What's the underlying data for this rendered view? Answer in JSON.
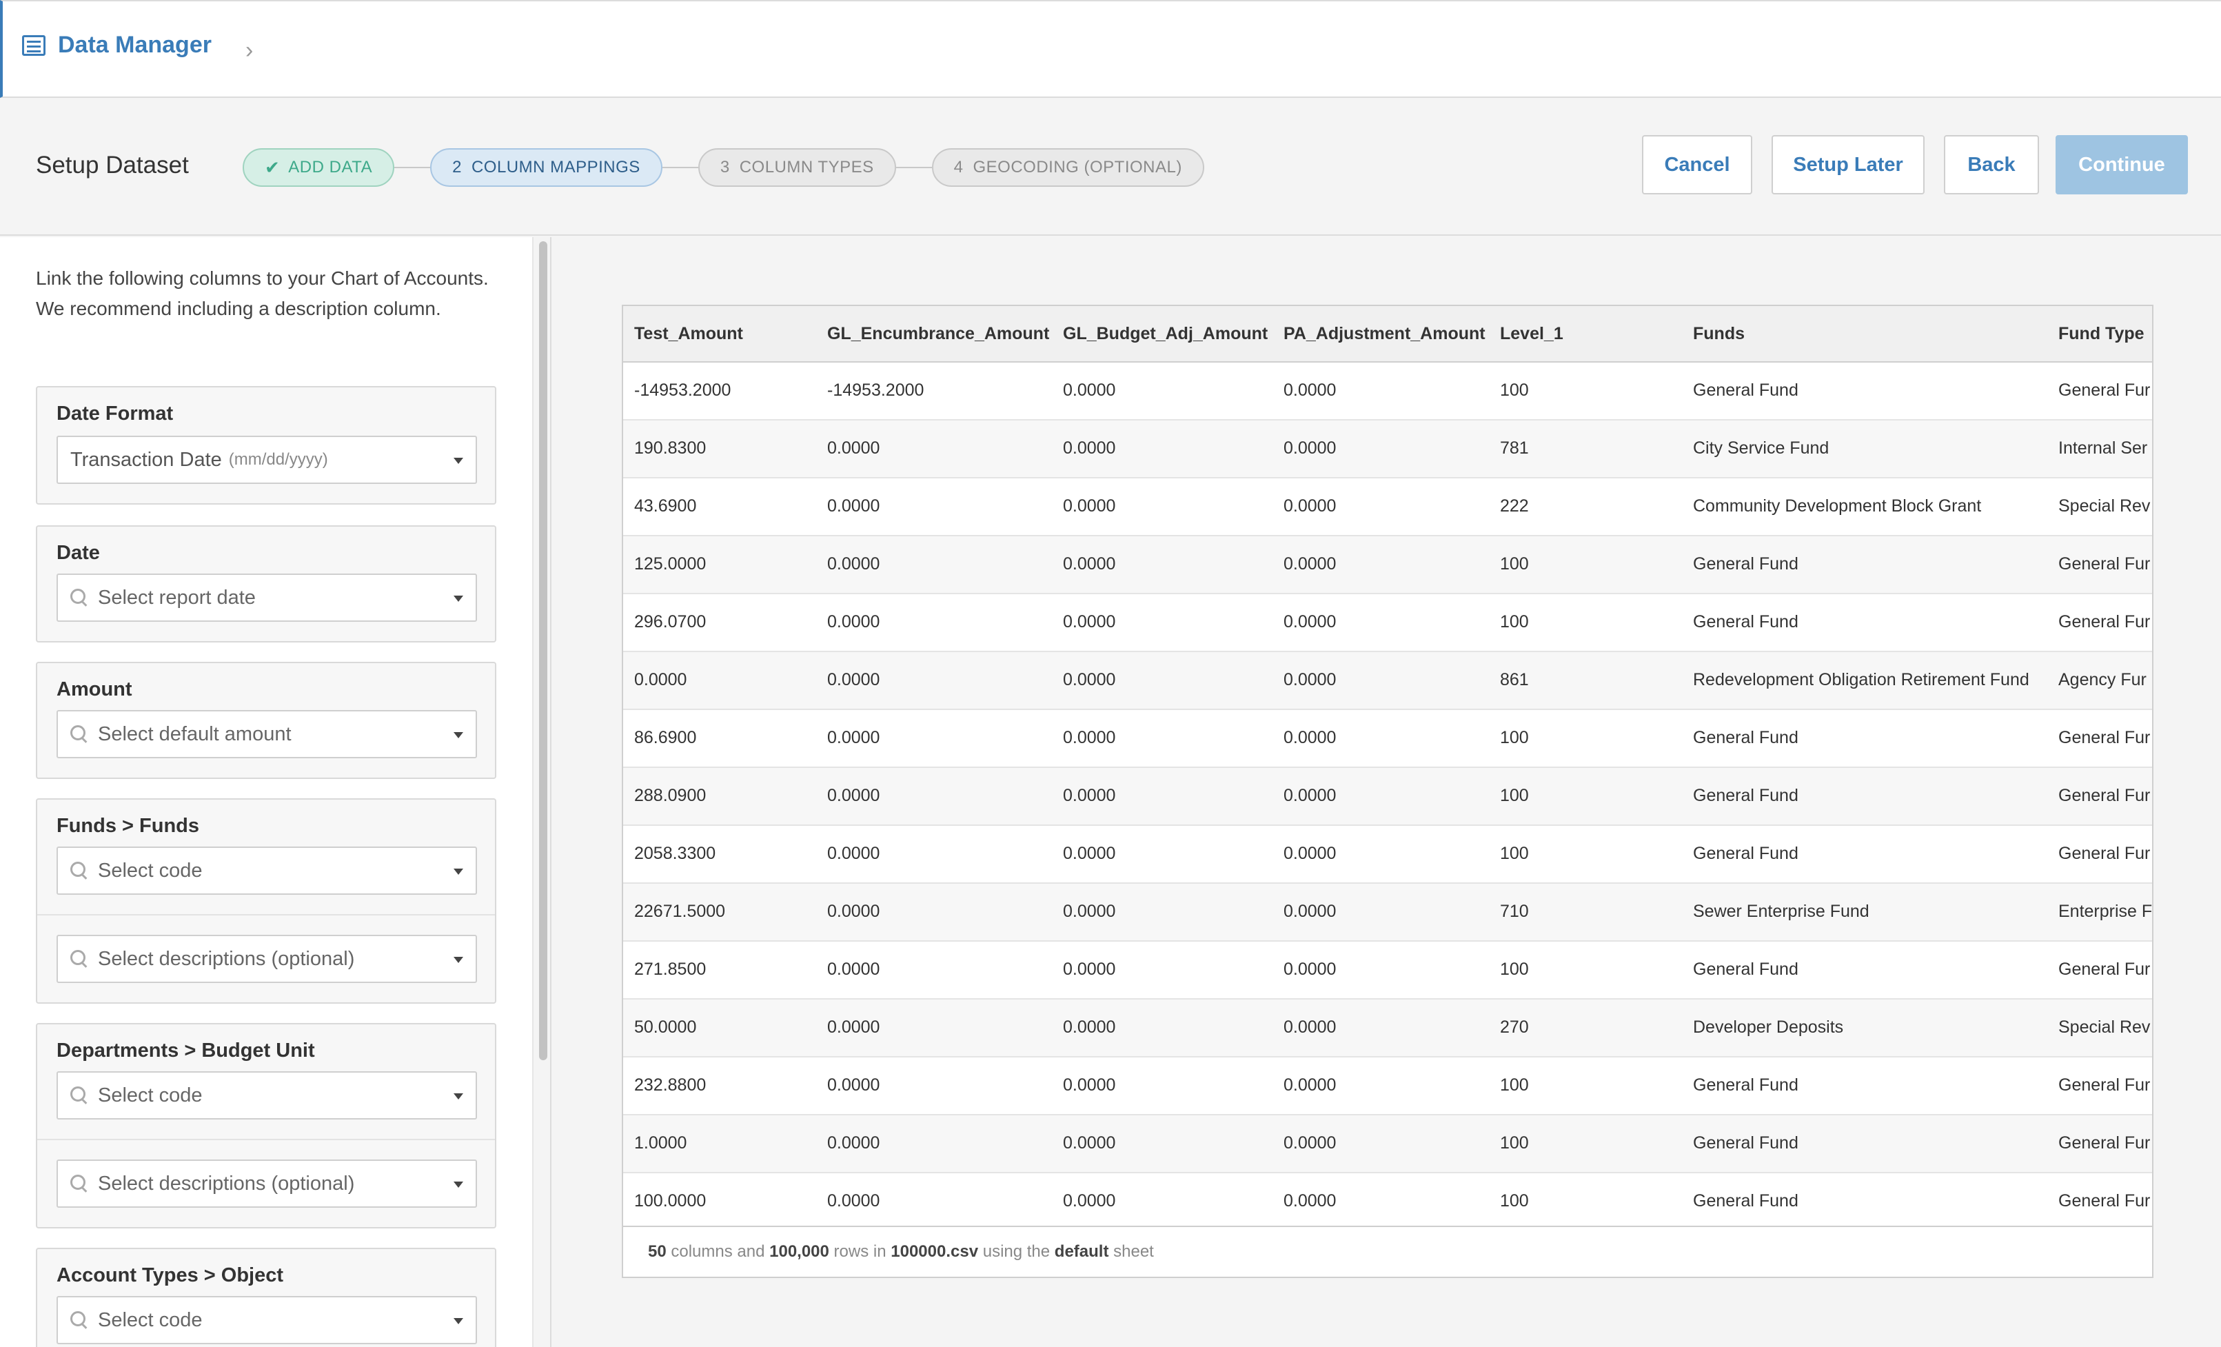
{
  "header": {
    "brand_icon": "monitor-icon",
    "title": "Data Manager",
    "chevron_icon": "chevron-right-icon",
    "chevron": "›"
  },
  "setup": {
    "title": "Setup Dataset",
    "steps": [
      {
        "num": "",
        "label": "ADD DATA",
        "state": "done",
        "check": "✔"
      },
      {
        "num": "2",
        "label": "COLUMN MAPPINGS",
        "state": "active"
      },
      {
        "num": "3",
        "label": "COLUMN TYPES",
        "state": "pending"
      },
      {
        "num": "4",
        "label": "GEOCODING (OPTIONAL)",
        "state": "pending"
      }
    ],
    "buttons": {
      "cancel": "Cancel",
      "setup_later": "Setup Later",
      "back": "Back",
      "continue": "Continue"
    }
  },
  "left": {
    "intro": "Link the following columns to your Chart of Accounts. We recommend including a description column.",
    "date_format": {
      "title": "Date Format",
      "value": "Transaction Date",
      "hint": "(mm/dd/yyyy)"
    },
    "date": {
      "title": "Date",
      "placeholder": "Select report date"
    },
    "amount": {
      "title": "Amount",
      "placeholder": "Select default amount"
    },
    "funds": {
      "title": "Funds > Funds",
      "code_placeholder": "Select code",
      "desc_placeholder": "Select descriptions (optional)"
    },
    "departments": {
      "title": "Departments > Budget Unit",
      "code_placeholder": "Select code",
      "desc_placeholder": "Select descriptions (optional)"
    },
    "account_types": {
      "title": "Account Types > Object",
      "code_placeholder": "Select code"
    }
  },
  "table": {
    "columns": [
      "Test_Amount",
      "GL_Encumbrance_Amount",
      "GL_Budget_Adj_Amount",
      "PA_Adjustment_Amount",
      "Level_1",
      "Funds",
      "Fund Type"
    ],
    "rows": [
      [
        "-14953.2000",
        "-14953.2000",
        "0.0000",
        "0.0000",
        "100",
        "General Fund",
        "General Fur"
      ],
      [
        "190.8300",
        "0.0000",
        "0.0000",
        "0.0000",
        "781",
        "City Service Fund",
        "Internal Ser"
      ],
      [
        "43.6900",
        "0.0000",
        "0.0000",
        "0.0000",
        "222",
        "Community Development Block Grant",
        "Special Rev"
      ],
      [
        "125.0000",
        "0.0000",
        "0.0000",
        "0.0000",
        "100",
        "General Fund",
        "General Fur"
      ],
      [
        "296.0700",
        "0.0000",
        "0.0000",
        "0.0000",
        "100",
        "General Fund",
        "General Fur"
      ],
      [
        "0.0000",
        "0.0000",
        "0.0000",
        "0.0000",
        "861",
        "Redevelopment Obligation Retirement Fund",
        "Agency Fur"
      ],
      [
        "86.6900",
        "0.0000",
        "0.0000",
        "0.0000",
        "100",
        "General Fund",
        "General Fur"
      ],
      [
        "288.0900",
        "0.0000",
        "0.0000",
        "0.0000",
        "100",
        "General Fund",
        "General Fur"
      ],
      [
        "2058.3300",
        "0.0000",
        "0.0000",
        "0.0000",
        "100",
        "General Fund",
        "General Fur"
      ],
      [
        "22671.5000",
        "0.0000",
        "0.0000",
        "0.0000",
        "710",
        "Sewer Enterprise Fund",
        "Enterprise F"
      ],
      [
        "271.8500",
        "0.0000",
        "0.0000",
        "0.0000",
        "100",
        "General Fund",
        "General Fur"
      ],
      [
        "50.0000",
        "0.0000",
        "0.0000",
        "0.0000",
        "270",
        "Developer Deposits",
        "Special Rev"
      ],
      [
        "232.8800",
        "0.0000",
        "0.0000",
        "0.0000",
        "100",
        "General Fund",
        "General Fur"
      ],
      [
        "1.0000",
        "0.0000",
        "0.0000",
        "0.0000",
        "100",
        "General Fund",
        "General Fur"
      ],
      [
        "100.0000",
        "0.0000",
        "0.0000",
        "0.0000",
        "100",
        "General Fund",
        "General Fur"
      ]
    ],
    "footer": {
      "columns": "50",
      "text1": " columns and ",
      "rows": "100,000",
      "text2": " rows in ",
      "file": "100000.csv",
      "text3": " using the ",
      "sheet": "default",
      "text4": " sheet"
    }
  },
  "colors": {
    "accent": "#3a7cb8",
    "done": "#3ea98a",
    "continue_bg": "#9ec4e2"
  }
}
